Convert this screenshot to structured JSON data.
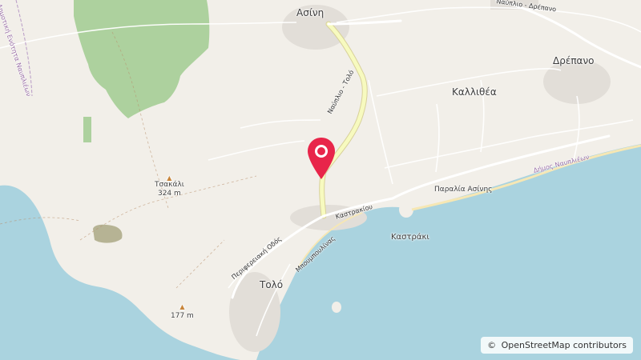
{
  "places": {
    "asini": "Ασίνη",
    "drepano": "Δρέπανο",
    "kallithea": "Καλλιθέα",
    "tolo": "Τολό",
    "kastraki": "Καστράκι",
    "paralia_asinis": "Παραλία Ασίνης"
  },
  "peaks": {
    "tsakali_name": "Τσακάλι",
    "tsakali_elev": "324 m",
    "unnamed_elev": "177 m"
  },
  "roads": {
    "nafplio_tolo": "Ναύπλιο - Τολό",
    "nafplio_drepano": "Ναύπλιο - Δρέπανο",
    "periferiaki_odos": "Περιφερειακή Οδός",
    "mpoumpoulinas": "Μπουμπουλίνας",
    "kastrakiou": "Καστρακίου"
  },
  "admin": {
    "dimotiki_enotita": "Δημοτική Ενότητα Ναυπλιέων",
    "dimos_nafplieon": "Δήμος Ναυπλιέων"
  },
  "attribution": {
    "symbol": "©",
    "text": "OpenStreetMap contributors"
  },
  "colors": {
    "land": "#f2efe9",
    "water": "#aad3df",
    "forest": "#add19e",
    "major_road": "#f7fabf",
    "marker": "#e8254a"
  }
}
